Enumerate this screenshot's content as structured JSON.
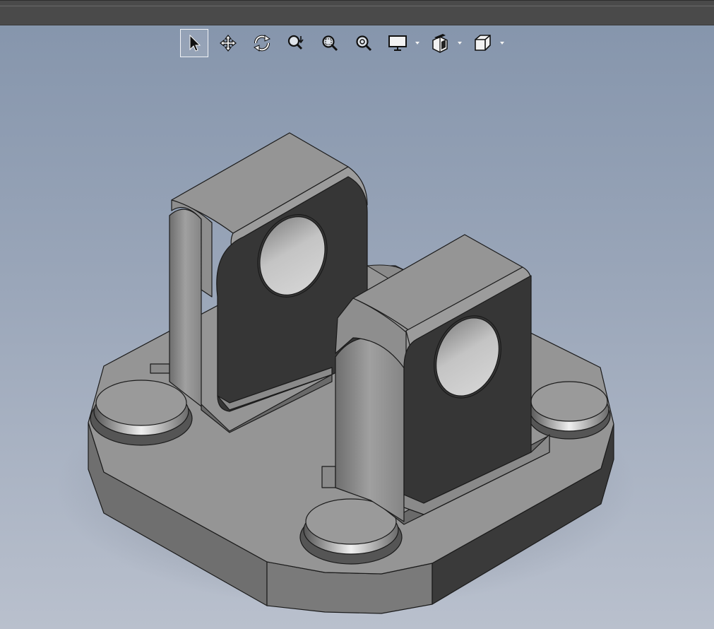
{
  "window": {
    "background_top": "#8494ab",
    "background_bottom": "#b9c0cd",
    "titlebar_color": "#4a4a4a"
  },
  "view_toolbar": {
    "tools": [
      {
        "name": "select",
        "icon": "select-arrow-icon",
        "active": true
      },
      {
        "name": "pan",
        "icon": "pan-icon",
        "active": false
      },
      {
        "name": "orbit",
        "icon": "orbit-icon",
        "active": false
      },
      {
        "name": "zoom",
        "icon": "zoom-icon",
        "active": false
      },
      {
        "name": "zoom-window",
        "icon": "zoom-window-icon",
        "active": false
      },
      {
        "name": "zoom-all",
        "icon": "zoom-all-icon",
        "active": false
      },
      {
        "name": "display-style",
        "icon": "display-monitor-icon",
        "active": false,
        "has_dropdown": true
      },
      {
        "name": "section-view",
        "icon": "section-view-icon",
        "active": false,
        "has_dropdown": true
      },
      {
        "name": "view-cube",
        "icon": "view-cube-icon",
        "active": false,
        "has_dropdown": true
      }
    ]
  },
  "model": {
    "part": "clevis-bracket-base",
    "colors": {
      "light_face": "#959595",
      "mid_face": "#7d7d7d",
      "dark_face": "#363636",
      "edge": "#1a1a1a",
      "hole": "#bdbdbd"
    }
  }
}
